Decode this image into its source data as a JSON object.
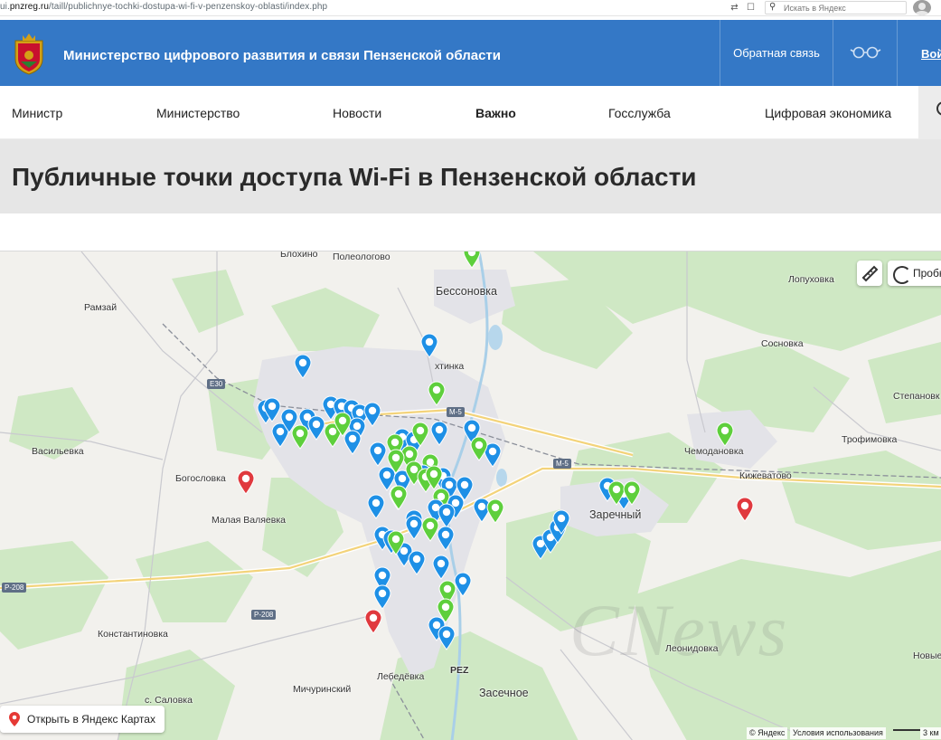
{
  "browser": {
    "url_prefix": "ui.",
    "url_host": "pnzreg.ru",
    "url_path": "/taill/publichnye-tochki-dostupa-wi-fi-v-penzenskoy-oblasti/index.php",
    "search_placeholder": "Искать в Яндекс"
  },
  "header": {
    "title": "Министерство цифрового развития и связи Пензенской области",
    "feedback": "Обратная связь",
    "login": "Вой"
  },
  "nav": {
    "items": [
      "Министр",
      "Министерство",
      "Новости",
      "Важно",
      "Госслужба",
      "Цифровая экономика"
    ]
  },
  "page": {
    "title": "Публичные точки доступа Wi-Fi в Пензенской области"
  },
  "map": {
    "labels": {
      "blokhino": "Блохино",
      "poleologovo": "Полеологово",
      "bessonovka": "Бессоновка",
      "lopukhovka": "Лопуховка",
      "ramzay": "Рамзай",
      "sosnovka": "Сосновка",
      "akhtinka": "хтинка",
      "stepanovka": "Степановк",
      "vasilyevka": "Васильевка",
      "chemodanovka": "Чемодановка",
      "trofimovka": "Трофимовка",
      "bogoslovka": "Богословка",
      "kizhevatovo": "Кижеватово",
      "malaya_valyaevka": "Малая Валяевка",
      "zarechny": "Заречный",
      "konstantinovka": "Константиновка",
      "leonidovka": "Леонидовка",
      "lebedevka": "Лебедёвка",
      "michurinsky": "Мичуринский",
      "zasechnoe": "Засечное",
      "salovka": "с. Саловка",
      "novye": "Новые",
      "pez": "PEZ"
    },
    "roads": {
      "e30": "E30",
      "m5a": "M-5",
      "m5b": "M-5",
      "r208a": "P-208",
      "r208b": "P-208"
    },
    "traffic": "Пробки",
    "open_button": "Открыть в Яндекс Картах",
    "copyright": "© Яндекс",
    "terms": "Условия использования",
    "scale": "3 км",
    "watermark": "CNews",
    "colors": {
      "blue_pin": "#1e90e6",
      "green_pin": "#5ecf3c",
      "red_pin": "#e0393e",
      "forest": "#cfe8c4",
      "city": "#e3e3e8"
    }
  }
}
